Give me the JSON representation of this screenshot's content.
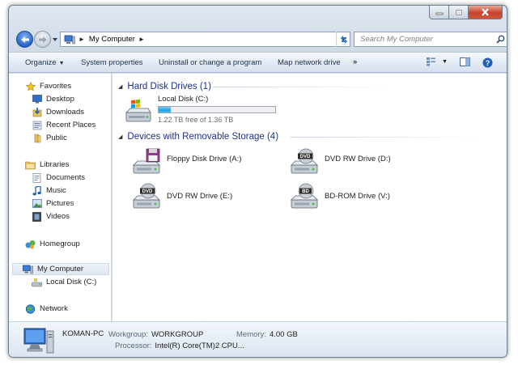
{
  "window": {
    "caption_buttons": [
      "minimize-icon",
      "maximize-icon",
      "close-icon"
    ]
  },
  "address": {
    "crumb": "My Computer",
    "separator": "►",
    "search_placeholder": "Search My Computer"
  },
  "toolbar": {
    "organize": "Organize",
    "system_properties": "System properties",
    "uninstall": "Uninstall or change a program",
    "map_drive": "Map network drive",
    "more": "»"
  },
  "nav": {
    "favorites": "Favorites",
    "desktop": "Desktop",
    "downloads": "Downloads",
    "recent": "Recent Places",
    "public": "Public",
    "libraries": "Libraries",
    "documents": "Documents",
    "music": "Music",
    "pictures": "Pictures",
    "videos": "Videos",
    "homegroup": "Homegroup",
    "my_computer": "My Computer",
    "local_disk": "Local Disk (C:)",
    "network": "Network"
  },
  "groups": {
    "hdd": "Hard Disk Drives (1)",
    "removable": "Devices with Removable Storage (4)"
  },
  "drives": {
    "c": {
      "name": "Local Disk (C:)",
      "free": "1.22 TB free of 1.36 TB",
      "used_fraction": 0.103
    },
    "a": {
      "name": "Floppy Disk Drive (A:)"
    },
    "d": {
      "name": "DVD RW Drive (D:)",
      "badge": "DVD"
    },
    "e": {
      "name": "DVD RW Drive (E:)",
      "badge": "DVD"
    },
    "v": {
      "name": "BD-ROM Drive (V:)",
      "badge": "BD"
    }
  },
  "details": {
    "pc_name": "KOMAN-PC",
    "workgroup_label": "Workgroup:",
    "workgroup": "WORKGROUP",
    "memory_label": "Memory:",
    "memory": "4.00 GB",
    "processor_label": "Processor:",
    "processor": "Intel(R) Core(TM)2 CPU..."
  },
  "colors": {
    "accent": "#1e3287",
    "usage_bar": "#27a0e4",
    "close_button": "#c7432b"
  }
}
